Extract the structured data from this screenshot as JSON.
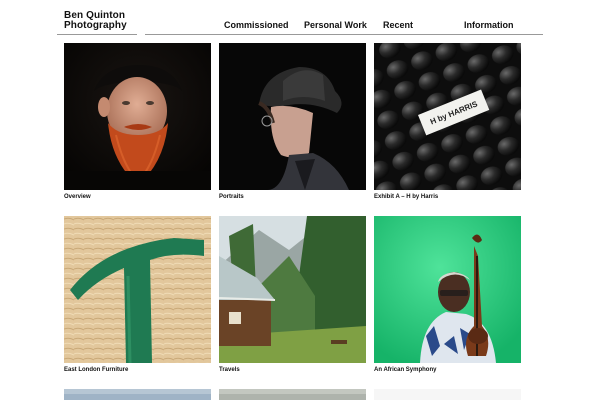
{
  "site": {
    "title_line1": "Ben Quinton",
    "title_line2": "Photography"
  },
  "nav": {
    "items": [
      {
        "label": "Commissioned"
      },
      {
        "label": "Personal Work"
      },
      {
        "label": "Recent"
      },
      {
        "label": "Information"
      }
    ]
  },
  "gallery": {
    "items": [
      {
        "caption": "Overview",
        "photo": "portrait-red-bearded-man"
      },
      {
        "caption": "Portraits",
        "photo": "portrait-man-in-hat-profile"
      },
      {
        "caption": "Exhibit A – H by Harris",
        "photo": "black-padded-fabric-with-label",
        "label_text": "H by HARRIS"
      },
      {
        "caption": "East London Furniture",
        "photo": "green-letter-on-wood-shavings"
      },
      {
        "caption": "Travels",
        "photo": "alpine-cabin-in-forest"
      },
      {
        "caption": "An African Symphony",
        "photo": "double-bass-player-on-green"
      }
    ]
  },
  "colors": {
    "background": "#ffffff",
    "text": "#111111",
    "rule": "#999999"
  }
}
